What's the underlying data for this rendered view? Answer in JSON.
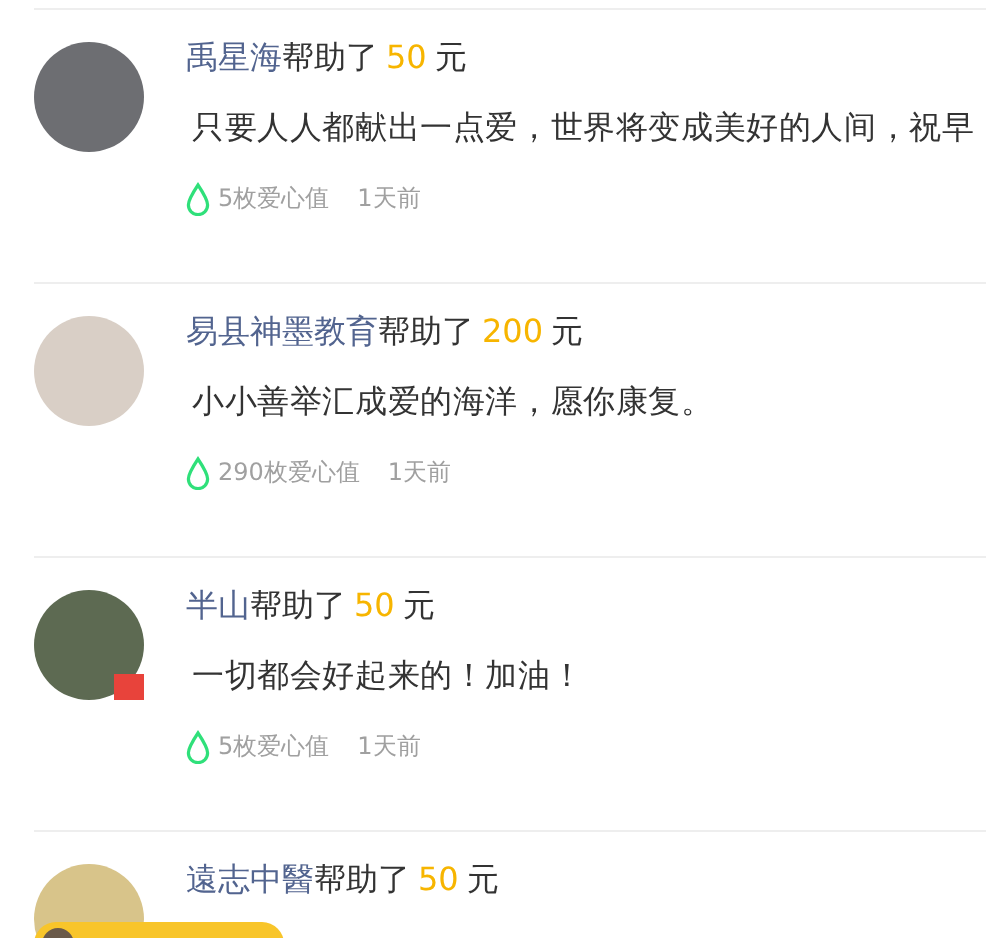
{
  "donations": [
    {
      "name": "禹星海",
      "helped_label": "帮助了",
      "amount": "50",
      "unit": "元",
      "message": "只要人人都献出一点爱，世界将变成美好的人间，祝早",
      "points": "5枚爱心值",
      "time": "1天前",
      "badge": false
    },
    {
      "name": "易县神墨教育",
      "helped_label": "帮助了",
      "amount": "200",
      "unit": "元",
      "message": "小小善举汇成爱的海洋，愿你康复。",
      "points": "290枚爱心值",
      "time": "1天前",
      "badge": false
    },
    {
      "name": "半山",
      "helped_label": "帮助了",
      "amount": "50",
      "unit": "元",
      "message": "一切都会好起来的！加油！",
      "points": "5枚爱心值",
      "time": "1天前",
      "badge": true
    },
    {
      "name": "遠志中醫",
      "helped_label": "帮助了",
      "amount": "50",
      "unit": "元",
      "badge": false
    }
  ]
}
